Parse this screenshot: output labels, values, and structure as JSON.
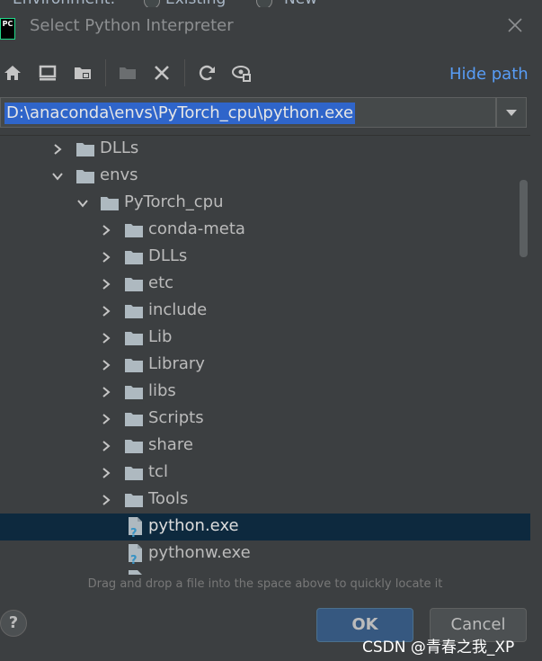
{
  "background_dialog": {
    "env_label": "Environment:",
    "existing_label": "Existing",
    "new_label": "New"
  },
  "titlebar": {
    "app_icon_text": "PC",
    "title": "Select Python Interpreter"
  },
  "toolbar": {
    "icons": [
      "home-icon",
      "desktop-icon",
      "project-folder-icon",
      "new-folder-icon",
      "delete-icon",
      "refresh-icon",
      "show-hidden-icon"
    ],
    "hide_path_label": "Hide path"
  },
  "path": {
    "value": "D:\\anaconda\\envs\\PyTorch_cpu\\python.exe"
  },
  "tree": {
    "rows": [
      {
        "label": "DLLs",
        "type": "folder",
        "state": "collapsed"
      },
      {
        "label": "envs",
        "type": "folder",
        "state": "expanded"
      },
      {
        "label": "PyTorch_cpu",
        "type": "folder",
        "state": "expanded"
      },
      {
        "label": "conda-meta",
        "type": "folder",
        "state": "collapsed"
      },
      {
        "label": "DLLs",
        "type": "folder",
        "state": "collapsed"
      },
      {
        "label": "etc",
        "type": "folder",
        "state": "collapsed"
      },
      {
        "label": "include",
        "type": "folder",
        "state": "collapsed"
      },
      {
        "label": "Lib",
        "type": "folder",
        "state": "collapsed"
      },
      {
        "label": "Library",
        "type": "folder",
        "state": "collapsed"
      },
      {
        "label": "libs",
        "type": "folder",
        "state": "collapsed"
      },
      {
        "label": "Scripts",
        "type": "folder",
        "state": "collapsed"
      },
      {
        "label": "share",
        "type": "folder",
        "state": "collapsed"
      },
      {
        "label": "tcl",
        "type": "folder",
        "state": "collapsed"
      },
      {
        "label": "Tools",
        "type": "folder",
        "state": "collapsed"
      },
      {
        "label": "python.exe",
        "type": "file",
        "selected": true
      },
      {
        "label": "pythonw.exe",
        "type": "file"
      }
    ]
  },
  "hint": "Drag and drop a file into the space above to quickly locate it",
  "buttons": {
    "help": "?",
    "ok": "OK",
    "cancel": "Cancel"
  },
  "watermark": "CSDN @青春之我_XP",
  "colors": {
    "accent": "#589df6",
    "selection": "#0d293e",
    "path_selection": "#2f65ca",
    "ok_button": "#365880",
    "folder": "#aeb9c0"
  }
}
